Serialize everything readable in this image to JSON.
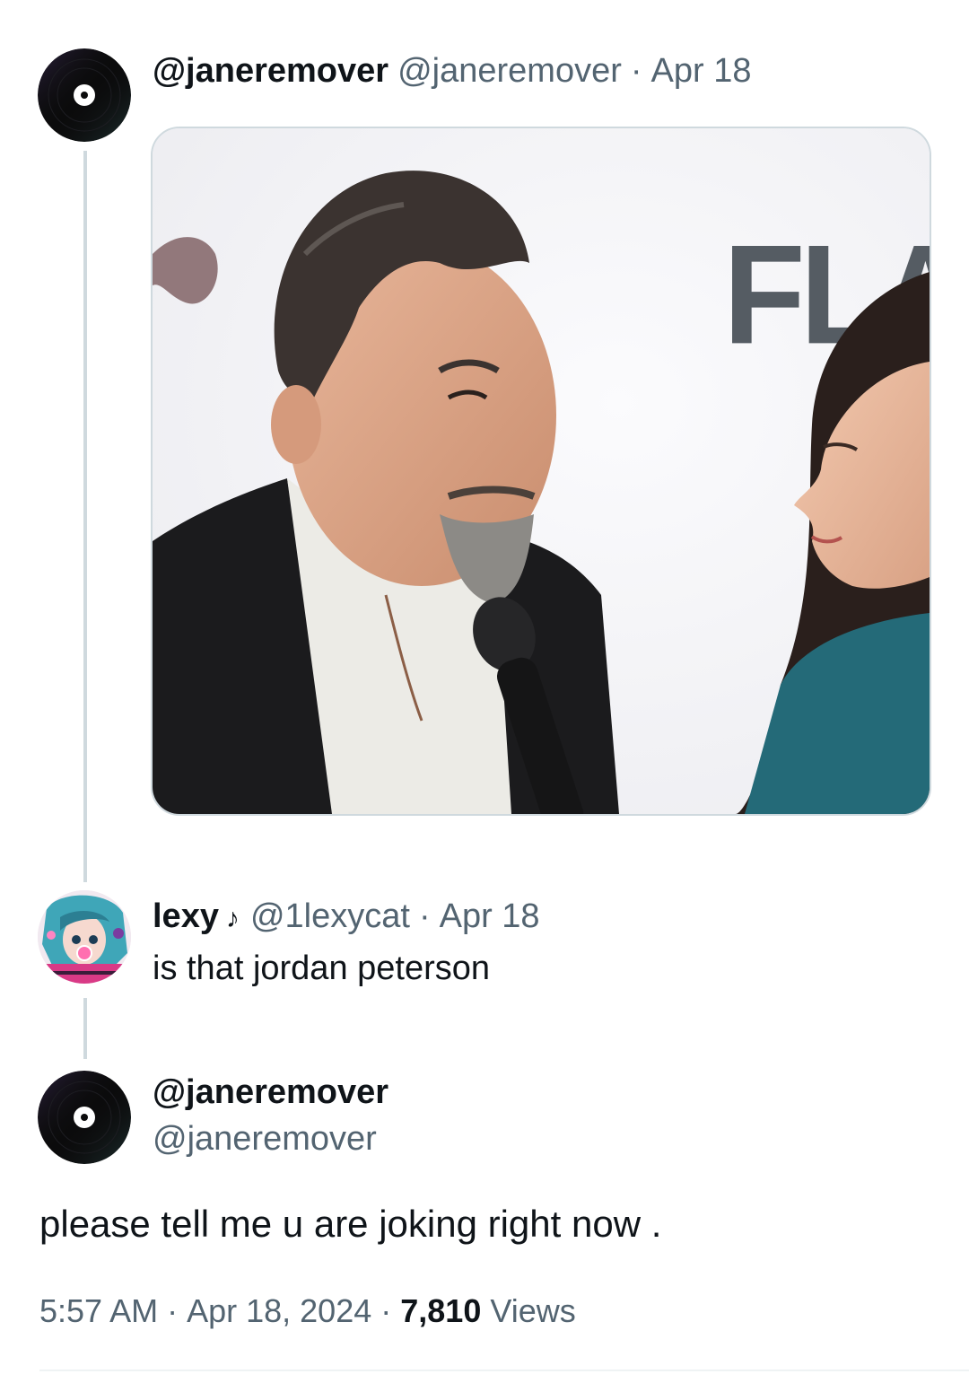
{
  "original_tweet": {
    "display_name": "@janeremover",
    "handle": "@janeremover",
    "separator": "·",
    "date": "Apr 18",
    "media": {
      "backdrop_text": "FLAI",
      "description_icon": "video-still"
    }
  },
  "reply": {
    "display_name": "lexy",
    "name_emoji": "♪",
    "handle": "@1lexycat",
    "separator": "·",
    "date": "Apr 18",
    "text": "is that jordan peterson"
  },
  "focus_tweet": {
    "display_name": "@janeremover",
    "handle": "@janeremover",
    "text": "please tell me u are joking right now .",
    "time": "5:57 AM",
    "sep1": "·",
    "date": "Apr 18, 2024",
    "sep2": "·",
    "views_count": "7,810",
    "views_label": "Views"
  },
  "colors": {
    "text_primary": "#0f1419",
    "text_secondary": "#536471",
    "thread_line": "#cfd9de"
  }
}
